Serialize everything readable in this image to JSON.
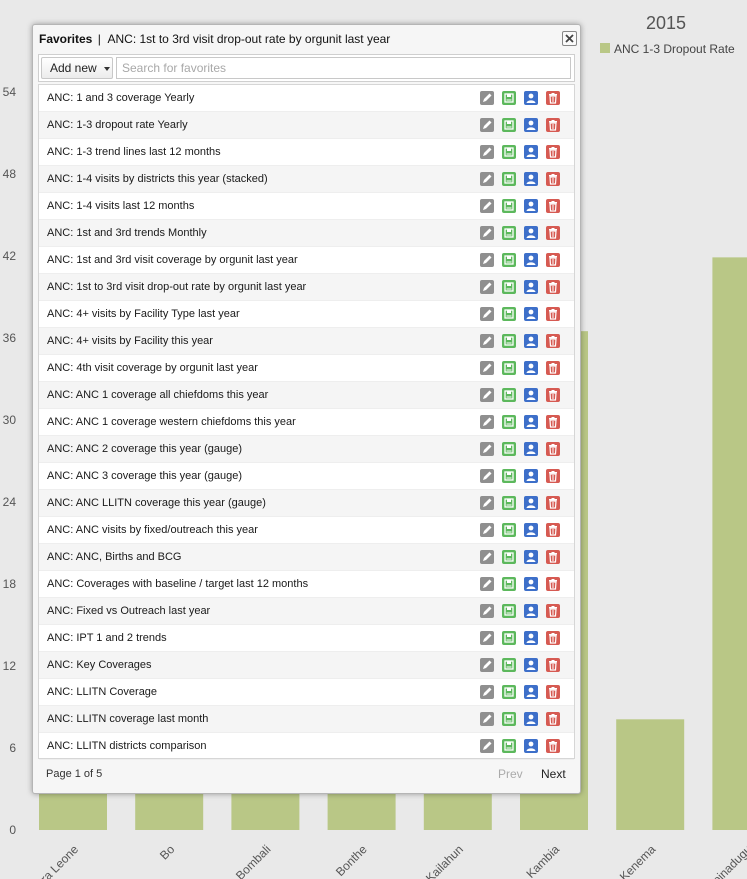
{
  "chart_data": {
    "type": "bar",
    "title": "2015",
    "legend": "ANC 1-3 Dropout Rate",
    "legend_position": "top-right",
    "ylim": [
      0,
      54
    ],
    "yticks": [
      0,
      6,
      12,
      18,
      24,
      30,
      36,
      42,
      48,
      54
    ],
    "grid": false,
    "categories": [
      "Sierra Leone",
      "Bo",
      "Bombali",
      "Bonthe",
      "Kailahun",
      "Kambia",
      "Kenema",
      "Koinadugu"
    ],
    "categories_visible": [
      "ra Leone",
      "Bo",
      "Bombali",
      "Bonthe",
      "Kailahun",
      "Kambia",
      "Kenema",
      "oinadugu"
    ],
    "values": [
      3,
      3,
      3,
      3,
      3,
      36.5,
      8.1,
      41.9
    ],
    "color": "#b9c786"
  },
  "favorites": {
    "title": "Favorites",
    "separator": "|",
    "subtitle": "ANC: 1st to 3rd visit drop-out rate by orgunit last year",
    "add_new_label": "Add new",
    "search_placeholder": "Search for favorites",
    "items": [
      "ANC: 1 and 3 coverage Yearly",
      "ANC: 1-3 dropout rate Yearly",
      "ANC: 1-3 trend lines last 12 months",
      "ANC: 1-4 visits by districts this year (stacked)",
      "ANC: 1-4 visits last 12 months",
      "ANC: 1st and 3rd trends Monthly",
      "ANC: 1st and 3rd visit coverage by orgunit last year",
      "ANC: 1st to 3rd visit drop-out rate by orgunit last year",
      "ANC: 4+ visits by Facility Type last year",
      "ANC: 4+ visits by Facility this year",
      "ANC: 4th visit coverage by orgunit last year",
      "ANC: ANC 1 coverage all chiefdoms this year",
      "ANC: ANC 1 coverage western chiefdoms this year",
      "ANC: ANC 2 coverage this year (gauge)",
      "ANC: ANC 3 coverage this year (gauge)",
      "ANC: ANC LLITN coverage this year (gauge)",
      "ANC: ANC visits by fixed/outreach this year",
      "ANC: ANC, Births and BCG",
      "ANC: Coverages with baseline / target last 12 months",
      "ANC: Fixed vs Outreach last year",
      "ANC: IPT 1 and 2 trends",
      "ANC: Key Coverages",
      "ANC: LLITN Coverage",
      "ANC: LLITN coverage last month",
      "ANC: LLITN districts comparison"
    ],
    "row_actions": [
      "pencil-icon",
      "overwrite-icon",
      "share-icon",
      "trash-icon"
    ],
    "page_info": "Page 1 of 5",
    "prev_label": "Prev",
    "next_label": "Next"
  }
}
